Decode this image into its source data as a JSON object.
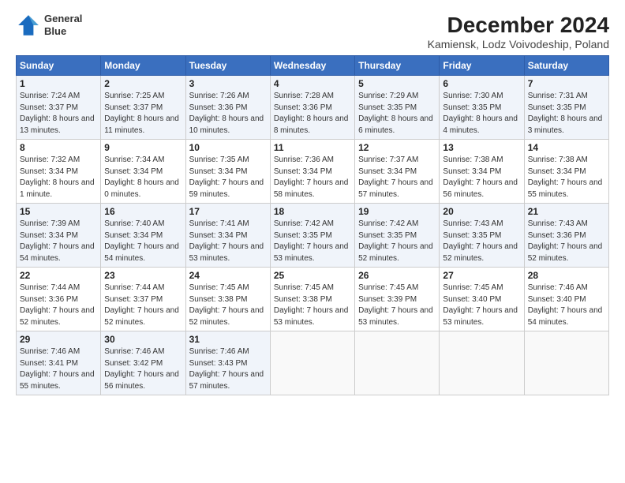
{
  "logo": {
    "line1": "General",
    "line2": "Blue"
  },
  "title": "December 2024",
  "subtitle": "Kamiensk, Lodz Voivodeship, Poland",
  "days_of_week": [
    "Sunday",
    "Monday",
    "Tuesday",
    "Wednesday",
    "Thursday",
    "Friday",
    "Saturday"
  ],
  "weeks": [
    [
      {
        "day": "1",
        "sunrise": "7:24 AM",
        "sunset": "3:37 PM",
        "daylight": "8 hours and 13 minutes."
      },
      {
        "day": "2",
        "sunrise": "7:25 AM",
        "sunset": "3:37 PM",
        "daylight": "8 hours and 11 minutes."
      },
      {
        "day": "3",
        "sunrise": "7:26 AM",
        "sunset": "3:36 PM",
        "daylight": "8 hours and 10 minutes."
      },
      {
        "day": "4",
        "sunrise": "7:28 AM",
        "sunset": "3:36 PM",
        "daylight": "8 hours and 8 minutes."
      },
      {
        "day": "5",
        "sunrise": "7:29 AM",
        "sunset": "3:35 PM",
        "daylight": "8 hours and 6 minutes."
      },
      {
        "day": "6",
        "sunrise": "7:30 AM",
        "sunset": "3:35 PM",
        "daylight": "8 hours and 4 minutes."
      },
      {
        "day": "7",
        "sunrise": "7:31 AM",
        "sunset": "3:35 PM",
        "daylight": "8 hours and 3 minutes."
      }
    ],
    [
      {
        "day": "8",
        "sunrise": "7:32 AM",
        "sunset": "3:34 PM",
        "daylight": "8 hours and 1 minute."
      },
      {
        "day": "9",
        "sunrise": "7:34 AM",
        "sunset": "3:34 PM",
        "daylight": "8 hours and 0 minutes."
      },
      {
        "day": "10",
        "sunrise": "7:35 AM",
        "sunset": "3:34 PM",
        "daylight": "7 hours and 59 minutes."
      },
      {
        "day": "11",
        "sunrise": "7:36 AM",
        "sunset": "3:34 PM",
        "daylight": "7 hours and 58 minutes."
      },
      {
        "day": "12",
        "sunrise": "7:37 AM",
        "sunset": "3:34 PM",
        "daylight": "7 hours and 57 minutes."
      },
      {
        "day": "13",
        "sunrise": "7:38 AM",
        "sunset": "3:34 PM",
        "daylight": "7 hours and 56 minutes."
      },
      {
        "day": "14",
        "sunrise": "7:38 AM",
        "sunset": "3:34 PM",
        "daylight": "7 hours and 55 minutes."
      }
    ],
    [
      {
        "day": "15",
        "sunrise": "7:39 AM",
        "sunset": "3:34 PM",
        "daylight": "7 hours and 54 minutes."
      },
      {
        "day": "16",
        "sunrise": "7:40 AM",
        "sunset": "3:34 PM",
        "daylight": "7 hours and 54 minutes."
      },
      {
        "day": "17",
        "sunrise": "7:41 AM",
        "sunset": "3:34 PM",
        "daylight": "7 hours and 53 minutes."
      },
      {
        "day": "18",
        "sunrise": "7:42 AM",
        "sunset": "3:35 PM",
        "daylight": "7 hours and 53 minutes."
      },
      {
        "day": "19",
        "sunrise": "7:42 AM",
        "sunset": "3:35 PM",
        "daylight": "7 hours and 52 minutes."
      },
      {
        "day": "20",
        "sunrise": "7:43 AM",
        "sunset": "3:35 PM",
        "daylight": "7 hours and 52 minutes."
      },
      {
        "day": "21",
        "sunrise": "7:43 AM",
        "sunset": "3:36 PM",
        "daylight": "7 hours and 52 minutes."
      }
    ],
    [
      {
        "day": "22",
        "sunrise": "7:44 AM",
        "sunset": "3:36 PM",
        "daylight": "7 hours and 52 minutes."
      },
      {
        "day": "23",
        "sunrise": "7:44 AM",
        "sunset": "3:37 PM",
        "daylight": "7 hours and 52 minutes."
      },
      {
        "day": "24",
        "sunrise": "7:45 AM",
        "sunset": "3:38 PM",
        "daylight": "7 hours and 52 minutes."
      },
      {
        "day": "25",
        "sunrise": "7:45 AM",
        "sunset": "3:38 PM",
        "daylight": "7 hours and 53 minutes."
      },
      {
        "day": "26",
        "sunrise": "7:45 AM",
        "sunset": "3:39 PM",
        "daylight": "7 hours and 53 minutes."
      },
      {
        "day": "27",
        "sunrise": "7:45 AM",
        "sunset": "3:40 PM",
        "daylight": "7 hours and 53 minutes."
      },
      {
        "day": "28",
        "sunrise": "7:46 AM",
        "sunset": "3:40 PM",
        "daylight": "7 hours and 54 minutes."
      }
    ],
    [
      {
        "day": "29",
        "sunrise": "7:46 AM",
        "sunset": "3:41 PM",
        "daylight": "7 hours and 55 minutes."
      },
      {
        "day": "30",
        "sunrise": "7:46 AM",
        "sunset": "3:42 PM",
        "daylight": "7 hours and 56 minutes."
      },
      {
        "day": "31",
        "sunrise": "7:46 AM",
        "sunset": "3:43 PM",
        "daylight": "7 hours and 57 minutes."
      },
      null,
      null,
      null,
      null
    ]
  ]
}
